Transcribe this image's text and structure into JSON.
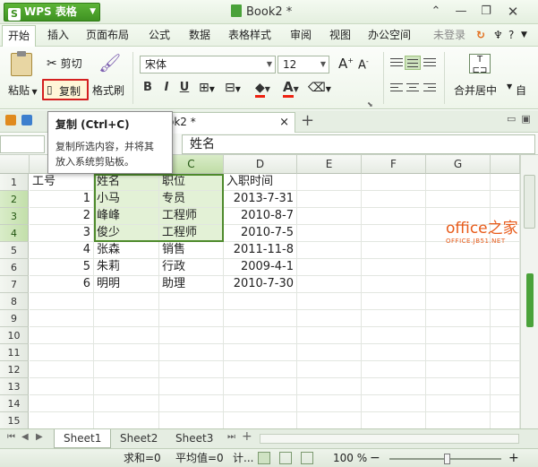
{
  "titlebar": {
    "app_name": "WPS 表格",
    "doc_title": "Book2 *"
  },
  "menubar": {
    "items": [
      "开始",
      "插入",
      "页面布局",
      "公式",
      "数据",
      "表格样式",
      "审阅",
      "视图",
      "办公空间"
    ],
    "login": "未登录",
    "help": "?"
  },
  "ribbon": {
    "paste": "粘贴",
    "cut": "剪切",
    "copy": "复制",
    "format_painter": "格式刷",
    "font_name": "宋体",
    "font_size": "12",
    "font_grow": "A",
    "font_shrink": "A",
    "bold": "B",
    "italic": "I",
    "underline": "U",
    "font_color_glyph": "A",
    "merge_center": "合并居中",
    "auto_wrap": "自"
  },
  "tooltip": {
    "title": "复制 (Ctrl+C)",
    "body_line1": "复制所选内容，并将其",
    "body_line2": "放入系统剪贴板。"
  },
  "doctab": {
    "label": "ok2 *",
    "close": "×",
    "new": "+"
  },
  "formula": {
    "value": "姓名"
  },
  "grid": {
    "columns": [
      "B",
      "C",
      "D",
      "E",
      "F",
      "G"
    ],
    "rows": [
      "1",
      "2",
      "3",
      "4",
      "5",
      "6",
      "7",
      "8",
      "9",
      "10",
      "11",
      "12",
      "13",
      "14",
      "15"
    ],
    "data": [
      [
        "工号",
        "姓名",
        "职位",
        "入职时间"
      ],
      [
        "1",
        "小马",
        "专员",
        "2013-7-31"
      ],
      [
        "2",
        "峰峰",
        "工程师",
        "2010-8-7"
      ],
      [
        "3",
        "俊少",
        "工程师",
        "2010-7-5"
      ],
      [
        "4",
        "张森",
        "销售",
        "2011-11-8"
      ],
      [
        "5",
        "朱莉",
        "行政",
        "2009-4-1"
      ],
      [
        "6",
        "明明",
        "助理",
        "2010-7-30"
      ]
    ]
  },
  "watermark": {
    "line1": "office之家",
    "line2": "OFFICE.JB51.NET"
  },
  "sheets": [
    "Sheet1",
    "Sheet2",
    "Sheet3"
  ],
  "sheet_add": "+",
  "status": {
    "sum": "求和=0",
    "avg": "平均值=0",
    "count": "计...",
    "zoom": "100 %",
    "zoom_level_pct": 100
  },
  "colors": {
    "accent": "#3f9222",
    "selection": "#4e8a2c",
    "highlight": "#e3f1d6",
    "copy_border": "#d42020"
  }
}
